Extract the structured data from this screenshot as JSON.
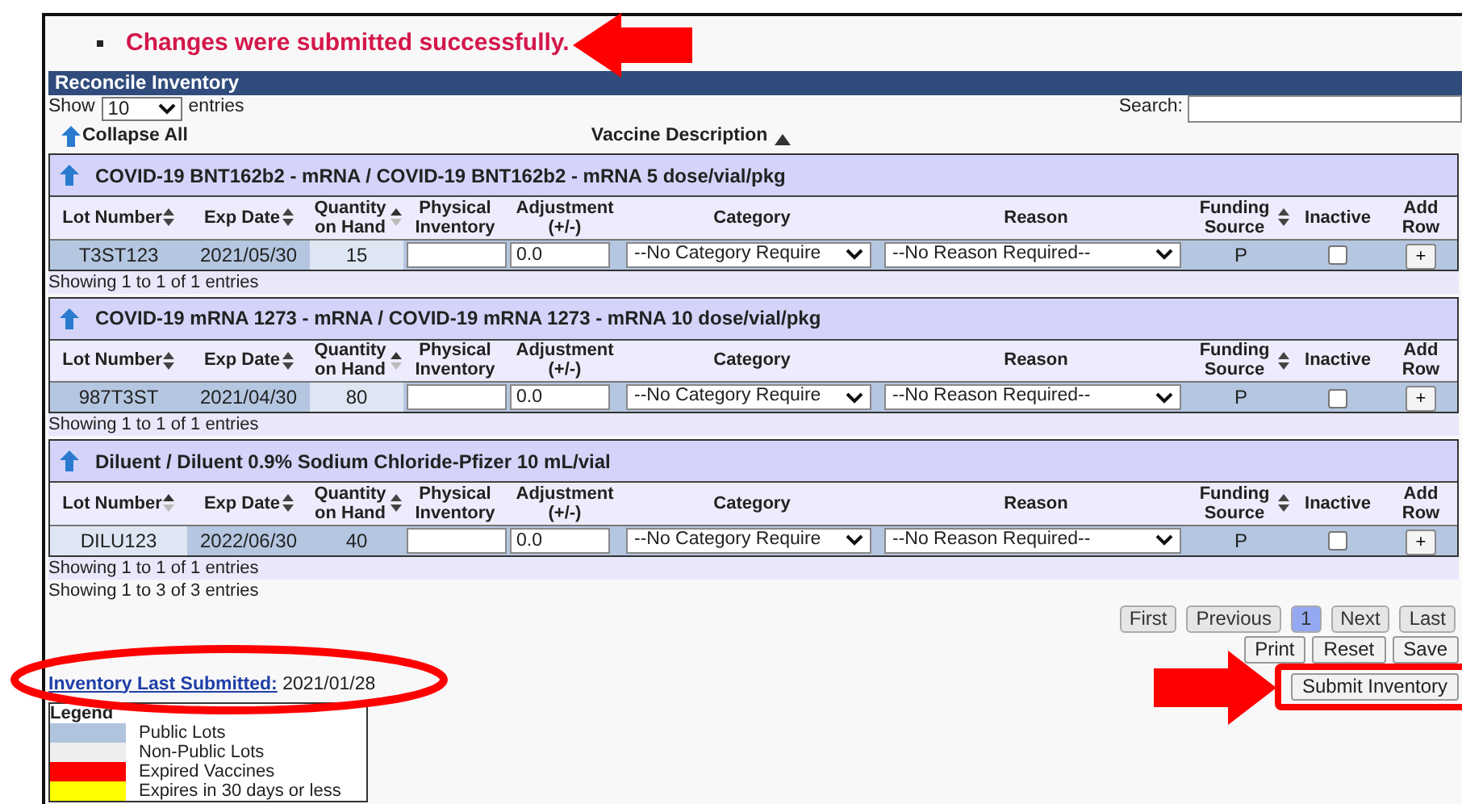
{
  "message": "Changes were submitted successfully.",
  "panel": {
    "title": "Reconcile Inventory",
    "show_label": "Show",
    "page_size": "10",
    "entries_label": "entries",
    "search_label": "Search:",
    "collapse_label": "Collapse All",
    "sort_label": "Vaccine Description"
  },
  "groups": [
    {
      "title": "COVID-19 BNT162b2 - mRNA / COVID-19 BNT162b2 - mRNA 5 dose/vial/pkg",
      "columns": [
        {
          "label": "Lot Number",
          "sortable": true,
          "sorted": false
        },
        {
          "label": "Exp Date",
          "sortable": true,
          "sorted": false
        },
        {
          "label": "Quantity on Hand",
          "sortable": true,
          "sorted": true
        },
        {
          "label": "Physical Inventory",
          "sortable": false,
          "sorted": false
        },
        {
          "label": "Adjustment (+/-)",
          "sortable": false,
          "sorted": false
        },
        {
          "label": "Category",
          "sortable": false,
          "sorted": false
        },
        {
          "label": "Reason",
          "sortable": false,
          "sorted": false
        },
        {
          "label": "Funding Source",
          "sortable": true,
          "sorted": false
        },
        {
          "label": "Inactive",
          "sortable": false,
          "sorted": false
        },
        {
          "label": "Add Row",
          "sortable": false,
          "sorted": false
        }
      ],
      "rows": [
        {
          "lot": "T3ST123",
          "exp": "2021/05/30",
          "qty": "15",
          "adjustment": "0.0",
          "category": "--No Category Require",
          "reason": "--No Reason Required--",
          "funding": "P",
          "inactive": false,
          "add": "+"
        }
      ],
      "info": "Showing 1 to 1 of 1 entries"
    },
    {
      "title": "COVID-19 mRNA 1273 - mRNA / COVID-19 mRNA 1273 - mRNA 10 dose/vial/pkg",
      "columns": [
        {
          "label": "Lot Number",
          "sortable": true,
          "sorted": false
        },
        {
          "label": "Exp Date",
          "sortable": true,
          "sorted": false
        },
        {
          "label": "Quantity on Hand",
          "sortable": true,
          "sorted": true
        },
        {
          "label": "Physical Inventory",
          "sortable": false,
          "sorted": false
        },
        {
          "label": "Adjustment (+/-)",
          "sortable": false,
          "sorted": false
        },
        {
          "label": "Category",
          "sortable": false,
          "sorted": false
        },
        {
          "label": "Reason",
          "sortable": false,
          "sorted": false
        },
        {
          "label": "Funding Source",
          "sortable": true,
          "sorted": false
        },
        {
          "label": "Inactive",
          "sortable": false,
          "sorted": false
        },
        {
          "label": "Add Row",
          "sortable": false,
          "sorted": false
        }
      ],
      "rows": [
        {
          "lot": "987T3ST",
          "exp": "2021/04/30",
          "qty": "80",
          "adjustment": "0.0",
          "category": "--No Category Require",
          "reason": "--No Reason Required--",
          "funding": "P",
          "inactive": false,
          "add": "+"
        }
      ],
      "info": "Showing 1 to 1 of 1 entries"
    },
    {
      "title": "Diluent / Diluent 0.9% Sodium Chloride-Pfizer 10 mL/vial",
      "columns": [
        {
          "label": "Lot Number",
          "sortable": true,
          "sorted": true
        },
        {
          "label": "Exp Date",
          "sortable": true,
          "sorted": false
        },
        {
          "label": "Quantity on Hand",
          "sortable": true,
          "sorted": false
        },
        {
          "label": "Physical Inventory",
          "sortable": false,
          "sorted": false
        },
        {
          "label": "Adjustment (+/-)",
          "sortable": false,
          "sorted": false
        },
        {
          "label": "Category",
          "sortable": false,
          "sorted": false
        },
        {
          "label": "Reason",
          "sortable": false,
          "sorted": false
        },
        {
          "label": "Funding Source",
          "sortable": true,
          "sorted": false
        },
        {
          "label": "Inactive",
          "sortable": false,
          "sorted": false
        },
        {
          "label": "Add Row",
          "sortable": false,
          "sorted": false
        }
      ],
      "rows": [
        {
          "lot": "DILU123",
          "exp": "2022/06/30",
          "qty": "40",
          "adjustment": "0.0",
          "category": "--No Category Require",
          "reason": "--No Reason Required--",
          "funding": "P",
          "inactive": false,
          "add": "+"
        }
      ],
      "info": "Showing 1 to 1 of 1 entries"
    }
  ],
  "summary": "Showing 1 to 3 of 3 entries",
  "pager": [
    {
      "label": "First",
      "selected": false
    },
    {
      "label": "Previous",
      "selected": false
    },
    {
      "label": "1",
      "selected": true
    },
    {
      "label": "Next",
      "selected": false
    },
    {
      "label": "Last",
      "selected": false
    }
  ],
  "actions": [
    "Print",
    "Reset",
    "Save"
  ],
  "submit": "Submit Inventory",
  "last_submitted": {
    "label": "Inventory Last Submitted:",
    "value": "2021/01/28"
  },
  "legend": {
    "title": "Legend",
    "items": [
      {
        "label": "Public Lots",
        "color": "#b0c4de"
      },
      {
        "label": "Non-Public Lots",
        "color": "#eeeeee"
      },
      {
        "label": "Expired Vaccines",
        "color": "#ff0000"
      },
      {
        "label": "Expires in 30 days or less",
        "color": "#ffff00"
      }
    ]
  },
  "annotations": [
    {
      "kind": "arrow-left"
    },
    {
      "kind": "ellipse"
    },
    {
      "kind": "arrow-right"
    },
    {
      "kind": "frame"
    }
  ]
}
